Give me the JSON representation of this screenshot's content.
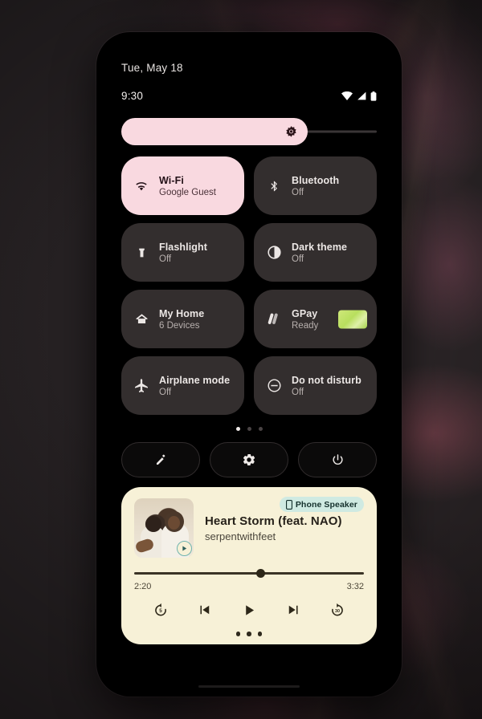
{
  "status_bar": {
    "date": "Tue, May 18",
    "clock": "9:30",
    "icons": [
      "wifi-icon",
      "cellular-signal-icon",
      "battery-icon"
    ]
  },
  "brightness": {
    "name": "brightness-slider",
    "icon": "brightness-icon",
    "fill_percent": 73
  },
  "tiles": [
    {
      "name": "wifi",
      "label": "Wi-Fi",
      "sub": "Google Guest",
      "icon": "wifi-icon",
      "active": true
    },
    {
      "name": "bluetooth",
      "label": "Bluetooth",
      "sub": "Off",
      "icon": "bluetooth-icon",
      "active": false
    },
    {
      "name": "flashlight",
      "label": "Flashlight",
      "sub": "Off",
      "icon": "flashlight-icon",
      "active": false
    },
    {
      "name": "dark-theme",
      "label": "Dark theme",
      "sub": "Off",
      "icon": "contrast-icon",
      "active": false
    },
    {
      "name": "my-home",
      "label": "My Home",
      "sub": "6 Devices",
      "icon": "home-icon",
      "active": false
    },
    {
      "name": "gpay",
      "label": "GPay",
      "sub": "Ready",
      "icon": "gpay-icon",
      "active": false,
      "card": true
    },
    {
      "name": "airplane-mode",
      "label": "Airplane mode",
      "sub": "Off",
      "icon": "airplane-icon",
      "active": false
    },
    {
      "name": "do-not-disturb",
      "label": "Do not disturb",
      "sub": "Off",
      "icon": "do-not-disturb-icon",
      "active": false
    }
  ],
  "page_dots": {
    "count": 3,
    "active_index": 0
  },
  "actions": [
    {
      "name": "edit-tiles",
      "icon": "pencil-icon"
    },
    {
      "name": "settings",
      "icon": "gear-icon"
    },
    {
      "name": "power",
      "icon": "power-icon"
    }
  ],
  "media": {
    "output_chip": {
      "label": "Phone Speaker",
      "icon": "phone-icon"
    },
    "title": "Heart Storm (feat. NAO)",
    "artist": "serpentwithfeet",
    "album_art_name": "album-art",
    "play_badge_icon": "play-badge-icon",
    "elapsed": "2:20",
    "duration": "3:32",
    "progress_percent": 55,
    "controls": [
      {
        "name": "replay-5",
        "icon": "replay-5-icon"
      },
      {
        "name": "previous",
        "icon": "skip-previous-icon"
      },
      {
        "name": "play",
        "icon": "play-icon"
      },
      {
        "name": "next",
        "icon": "skip-next-icon"
      },
      {
        "name": "forward-30",
        "icon": "forward-30-icon"
      }
    ],
    "dots": 3
  },
  "colors": {
    "accent_pink": "#F9D9E0",
    "tile_inactive": "#332E2E",
    "player_bg": "#F7F1D7",
    "chip_bg": "#CFEAE2",
    "gpay_card": "#B8DF5E"
  }
}
